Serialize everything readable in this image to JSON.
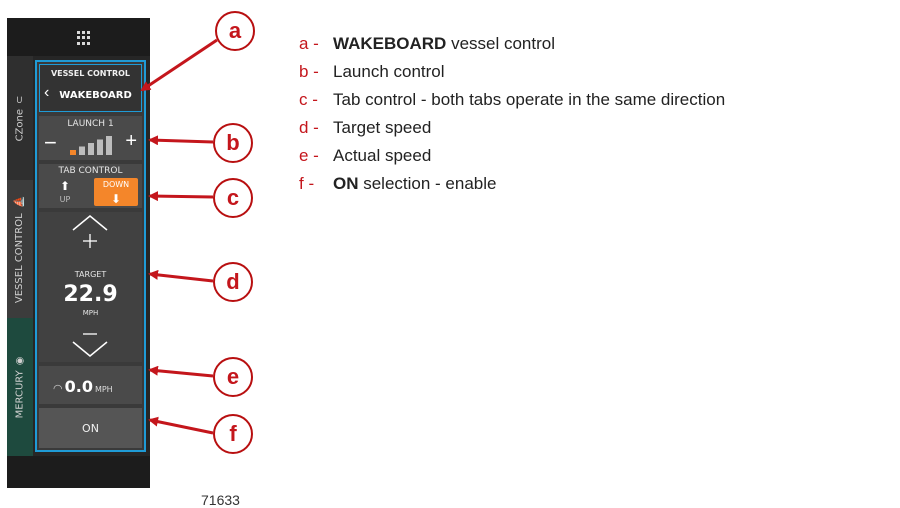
{
  "device": {
    "side_tabs": {
      "czone": "CZone",
      "vessel_control": "VESSEL CONTROL",
      "mercury": "MERCURY"
    },
    "vessel_control": {
      "title": "VESSEL CONTROL",
      "value": "WAKEBOARD"
    },
    "launch": {
      "title": "LAUNCH 1",
      "level": 1,
      "max_level": 5
    },
    "tab_control": {
      "title": "TAB CONTROL",
      "up": "UP",
      "down": "DOWN"
    },
    "target": {
      "label": "TARGET",
      "value": "22.9",
      "unit": "MPH"
    },
    "actual": {
      "value": "0.0",
      "unit": "MPH"
    },
    "on_button": "ON"
  },
  "callouts": [
    "a",
    "b",
    "c",
    "d",
    "e",
    "f"
  ],
  "legend": [
    {
      "key": "a -",
      "bold": "WAKEBOARD",
      "text": " vessel control"
    },
    {
      "key": "b -",
      "bold": "",
      "text": "Launch control"
    },
    {
      "key": "c -",
      "bold": "",
      "text": "Tab control - both tabs operate in the same direction"
    },
    {
      "key": "d -",
      "bold": "",
      "text": "Target speed"
    },
    {
      "key": "e -",
      "bold": "",
      "text": "Actual speed"
    },
    {
      "key": "f -",
      "bold": "ON",
      "text": " selection - enable"
    }
  ],
  "figure_number": "71633",
  "colors": {
    "accent": "#1f9bd6",
    "tab_active": "#f4862a",
    "callout": "#c4161c",
    "mercury_tab": "#1e4a3e"
  }
}
